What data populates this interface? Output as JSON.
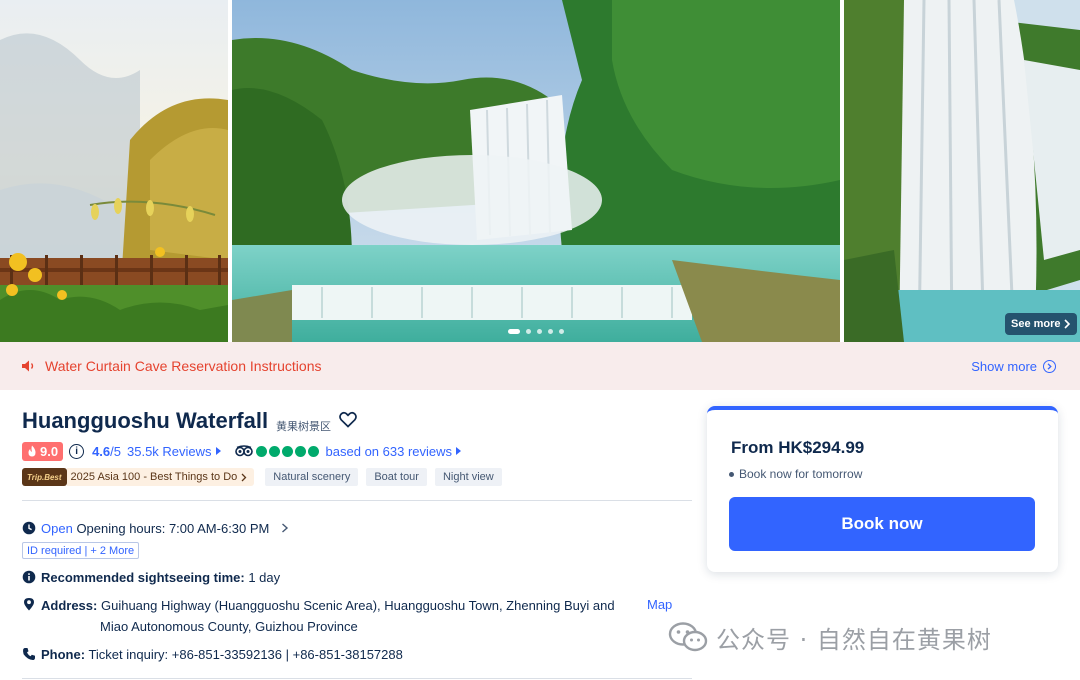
{
  "gallery": {
    "see_more": "See more",
    "dots_count": 5,
    "active_dot": 0
  },
  "notice": {
    "text": "Water Curtain Cave Reservation Instructions",
    "show_more": "Show more"
  },
  "attraction": {
    "name": "Huangguoshu Waterfall",
    "name_cn": "黄果树景区",
    "trip_score": "9.0",
    "rating": "4.6",
    "rating_of": "/5",
    "reviews": "35.5k Reviews",
    "tripadvisor_bubbles": 5,
    "tripadvisor_text": "based on 633 reviews",
    "trip_best_badge": "Trip.Best",
    "trip_best_text": "2025 Asia 100 - Best Things to Do",
    "tags": [
      "Natural scenery",
      "Boat tour",
      "Night view"
    ]
  },
  "details": {
    "open_status": "Open",
    "hours": "Opening hours: 7:00 AM-6:30 PM",
    "requirement": "ID required | + 2 More",
    "sightseeing_label": "Recommended sightseeing time:",
    "sightseeing_value": "1 day",
    "address_label": "Address:",
    "address_line1": "Guihuang Highway (Huangguoshu Scenic Area), Huangguoshu Town, Zhenning Buyi and",
    "address_line2": "Miao Autonomous County, Guizhou Province",
    "map_link": "Map",
    "phone_label": "Phone:",
    "phone_value": "Ticket inquiry: +86-851-33592136 | +86-851-38157288"
  },
  "booking": {
    "price": "From HK$294.99",
    "note": "Book now for tomorrow",
    "button": "Book now"
  },
  "watermark": {
    "text": "公众号 · 自然自在黄果树"
  },
  "colors": {
    "accent": "#3264ff",
    "notice_bg": "#f8ecec",
    "notice_text": "#e5432f",
    "score_badge": "#ff6f6f",
    "tripadvisor_green": "#00aa6c"
  }
}
